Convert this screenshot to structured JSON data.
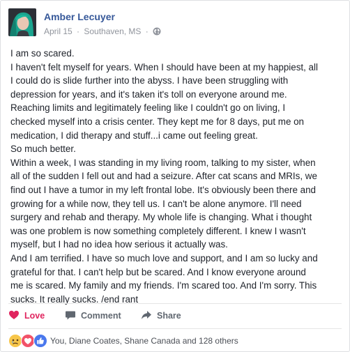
{
  "post": {
    "author": "Amber Lecuyer",
    "date": "April 15",
    "location": "Southaven, MS",
    "separator": "·",
    "privacy_icon": "globe-icon",
    "lines": [
      "I am so scared.",
      "I haven't felt myself for years. When I should have been at my happiest, all",
      "I could do is slide further into the abyss. I have been struggling with",
      "depression for years, and it's taken it's toll on everyone around me.",
      "Reaching limits and legitimately feeling like I couldn't go on living, I",
      "checked myself into a crisis center. They kept me for 8 days, put me on",
      "medication, I did therapy and stuff...i came out feeling great.",
      "So much better.",
      "Within a week, I was standing in my living room, talking to my sister, when",
      "all of the sudden I fell out and had a seizure. After cat scans and MRIs, we",
      "find out I have a tumor in my left frontal lobe. It's obviously been there and",
      "growing for a while now, they tell us. I can't be alone anymore. I'll need",
      "surgery and rehab and therapy. My whole life is changing. What i thought",
      "was one problem is now something completely different. I knew I wasn't",
      "myself, but I had no idea how serious it actually was.",
      "And I am terrified. I have so much love and support, and I am so lucky and",
      "grateful for that. I can't help but be scared. And I know everyone around",
      "me is scared. My family and my friends. I'm scared too. And I'm sorry. This",
      "sucks. It really sucks. /end rant"
    ]
  },
  "actions": {
    "love": {
      "label": "Love",
      "icon": "heart-icon",
      "color": "#e0245e"
    },
    "comment": {
      "label": "Comment",
      "icon": "comment-icon"
    },
    "share": {
      "label": "Share",
      "icon": "share-arrow-icon"
    }
  },
  "reactions": {
    "icons": [
      "sad-icon",
      "love-icon",
      "like-icon"
    ],
    "summary": "You, Diane Coates, Shane Canada and 128 others"
  },
  "colors": {
    "link": "#365899",
    "meta": "#90949c",
    "action": "#606770",
    "divider": "#e5e5e5"
  }
}
